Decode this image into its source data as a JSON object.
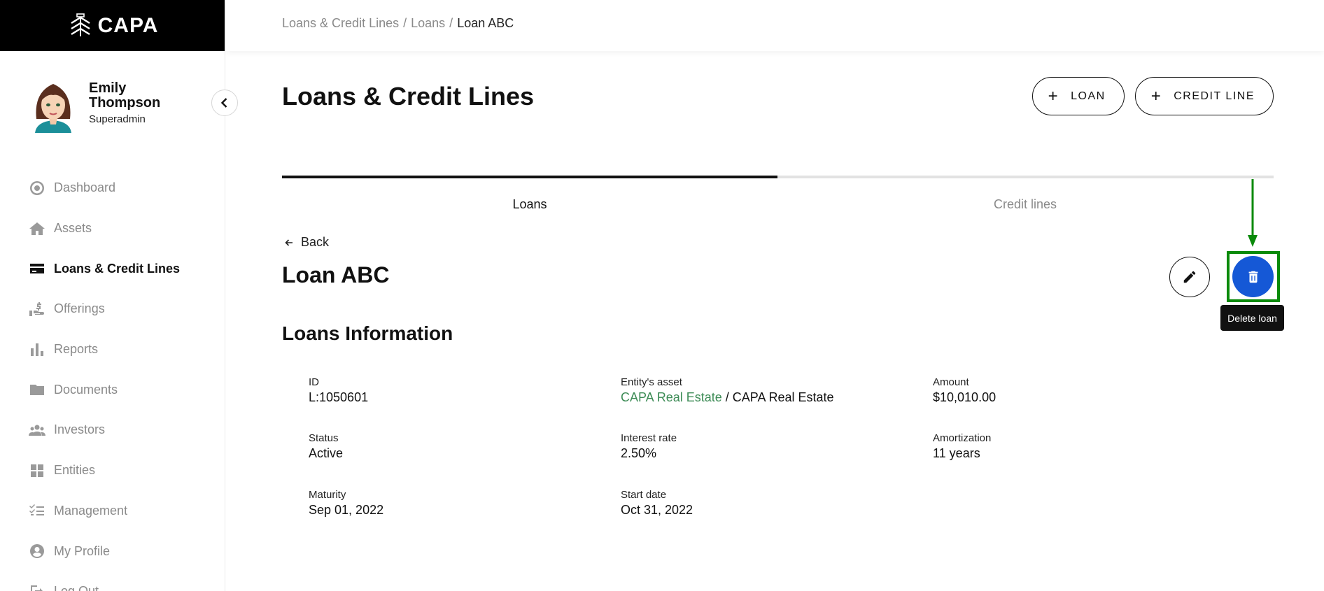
{
  "brand": {
    "logo_text": "CAPA"
  },
  "profile": {
    "name": "Emily Thompson",
    "role": "Superadmin"
  },
  "nav": [
    {
      "label": "Dashboard",
      "icon": "dashboard-icon",
      "active": false
    },
    {
      "label": "Assets",
      "icon": "home-icon",
      "active": false
    },
    {
      "label": "Loans & Credit Lines",
      "icon": "credit-card-icon",
      "active": true
    },
    {
      "label": "Offerings",
      "icon": "hand-dollar-icon",
      "active": false
    },
    {
      "label": "Reports",
      "icon": "bar-chart-icon",
      "active": false
    },
    {
      "label": "Documents",
      "icon": "folder-icon",
      "active": false
    },
    {
      "label": "Investors",
      "icon": "people-icon",
      "active": false
    },
    {
      "label": "Entities",
      "icon": "grid-icon",
      "active": false
    },
    {
      "label": "Management",
      "icon": "checklist-icon",
      "active": false
    },
    {
      "label": "My Profile",
      "icon": "user-circle-icon",
      "active": false
    },
    {
      "label": "Log Out",
      "icon": "logout-icon",
      "active": false
    }
  ],
  "breadcrumb": {
    "part1": "Loans & Credit Lines",
    "part2": "Loans",
    "current": "Loan ABC",
    "separator": "/"
  },
  "header": {
    "title": "Loans & Credit Lines",
    "add_loan_label": "LOAN",
    "add_credit_line_label": "CREDIT LINE"
  },
  "tabs": {
    "loans": "Loans",
    "credit_lines": "Credit lines"
  },
  "detail": {
    "back_label": "Back",
    "loan_title": "Loan ABC",
    "delete_tooltip": "Delete loan",
    "section_title": "Loans Information"
  },
  "info": {
    "id": {
      "label": "ID",
      "value": "L:1050601"
    },
    "entity_asset": {
      "label": "Entity's asset",
      "entity": "CAPA Real Estate",
      "separator": " / ",
      "asset": "CAPA Real Estate"
    },
    "amount": {
      "label": "Amount",
      "value": "$10,010.00"
    },
    "status": {
      "label": "Status",
      "value": "Active"
    },
    "interest_rate": {
      "label": "Interest rate",
      "value": "2.50%"
    },
    "amortization": {
      "label": "Amortization",
      "value": "11 years"
    },
    "maturity": {
      "label": "Maturity",
      "value": "Sep 01, 2022"
    },
    "start_date": {
      "label": "Start date",
      "value": "Oct 31, 2022"
    }
  },
  "colors": {
    "primary_blue": "#1558d6",
    "highlight_green": "#0a8a0a",
    "link_green": "#3c8b55"
  }
}
